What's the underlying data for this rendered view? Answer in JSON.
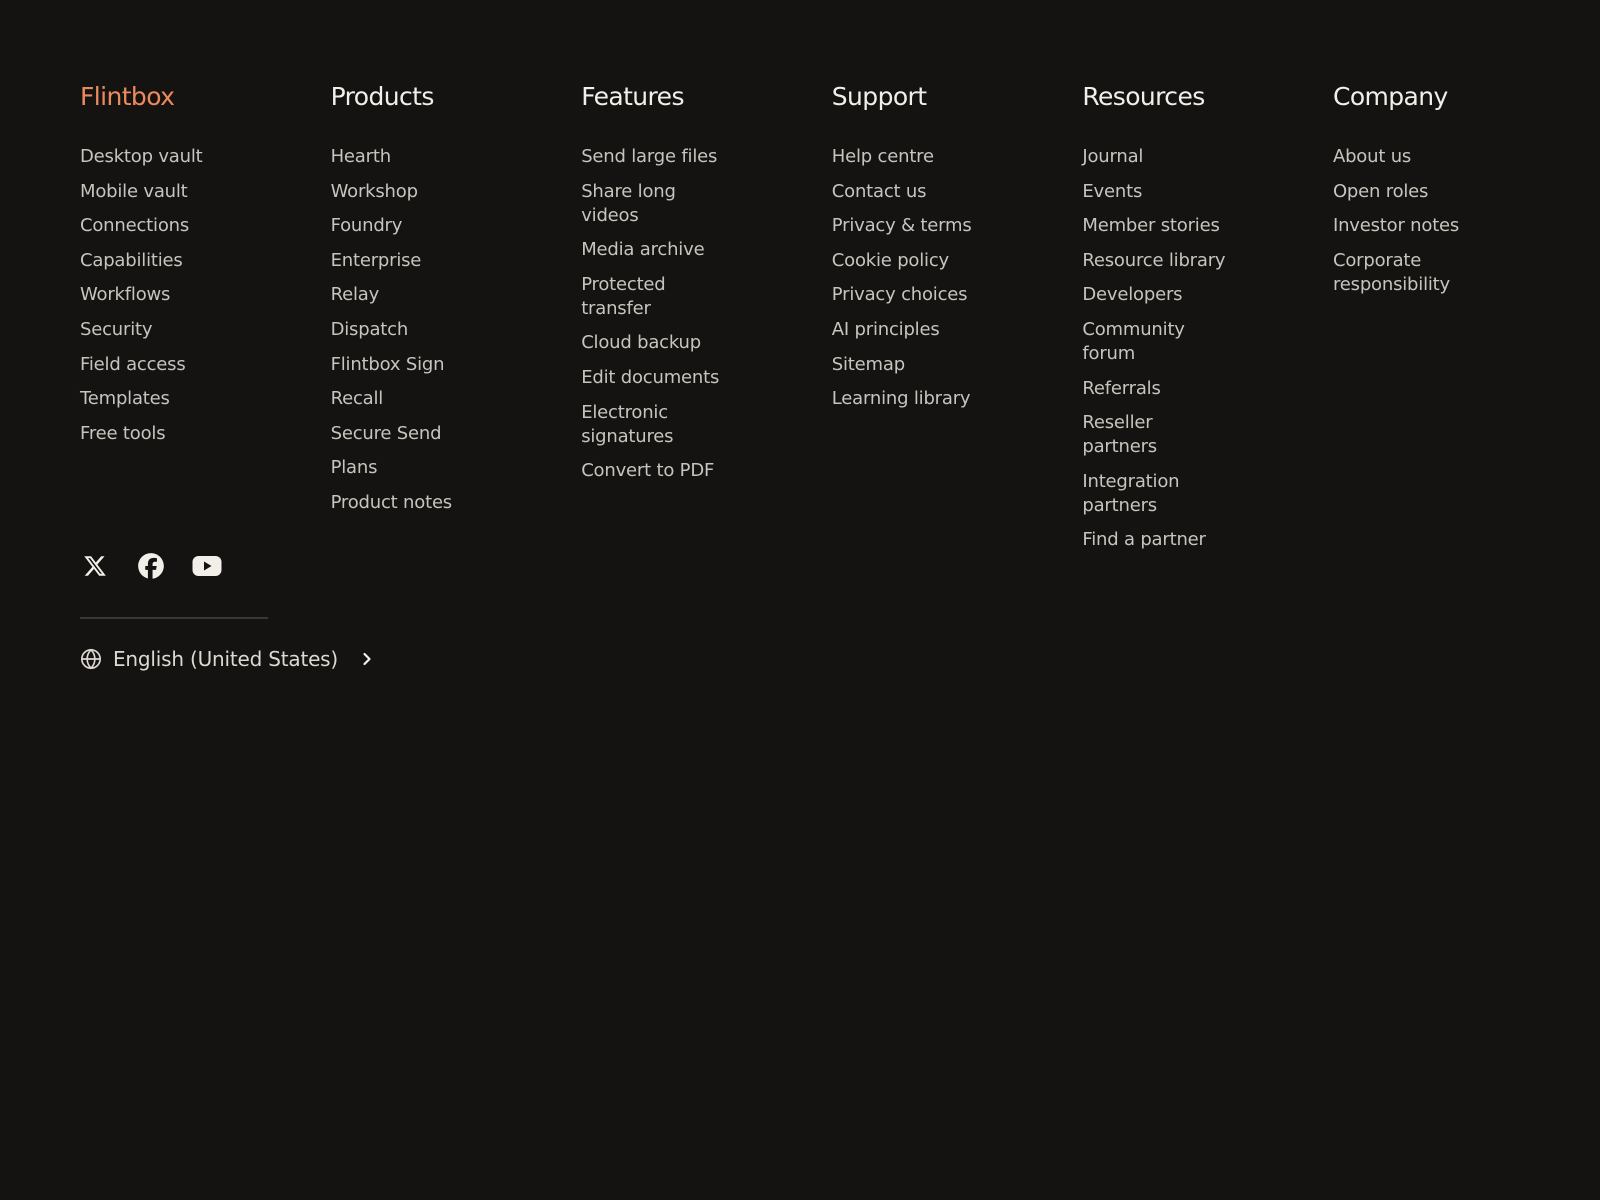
{
  "columns": [
    {
      "title": "Flintbox",
      "links": [
        "Desktop vault",
        "Mobile vault",
        "Connections",
        "Capabilities",
        "Workflows",
        "Security",
        "Field access",
        "Templates",
        "Free tools"
      ]
    },
    {
      "title": "Products",
      "links": [
        "Hearth",
        "Workshop",
        "Foundry",
        "Enterprise",
        "Relay",
        "Dispatch",
        "Flintbox Sign",
        "Recall",
        "Secure Send",
        "Plans",
        "Product notes"
      ]
    },
    {
      "title": "Features",
      "links": [
        "Send large files",
        "Share long videos",
        "Media archive",
        "Protected transfer",
        "Cloud backup",
        "Edit documents",
        "Electronic signatures",
        "Convert to PDF"
      ]
    },
    {
      "title": "Support",
      "links": [
        "Help centre",
        "Contact us",
        "Privacy & terms",
        "Cookie policy",
        "Privacy choices",
        "AI principles",
        "Sitemap",
        "Learning library"
      ]
    },
    {
      "title": "Resources",
      "links": [
        "Journal",
        "Events",
        "Member stories",
        "Resource library",
        "Developers",
        "Community forum",
        "Referrals",
        "Reseller partners",
        "Integration partners",
        "Find a partner"
      ]
    },
    {
      "title": "Company",
      "links": [
        "About us",
        "Open roles",
        "Investor notes",
        "Corporate responsibility"
      ]
    }
  ],
  "social": [
    {
      "name": "x-icon"
    },
    {
      "name": "facebook-icon"
    },
    {
      "name": "youtube-icon"
    }
  ],
  "locale": {
    "label": "English (United States)"
  },
  "colors": {
    "background": "#141312",
    "brand": "#ec8a5e",
    "heading": "#f2efe9",
    "link": "#c8c4bd"
  }
}
